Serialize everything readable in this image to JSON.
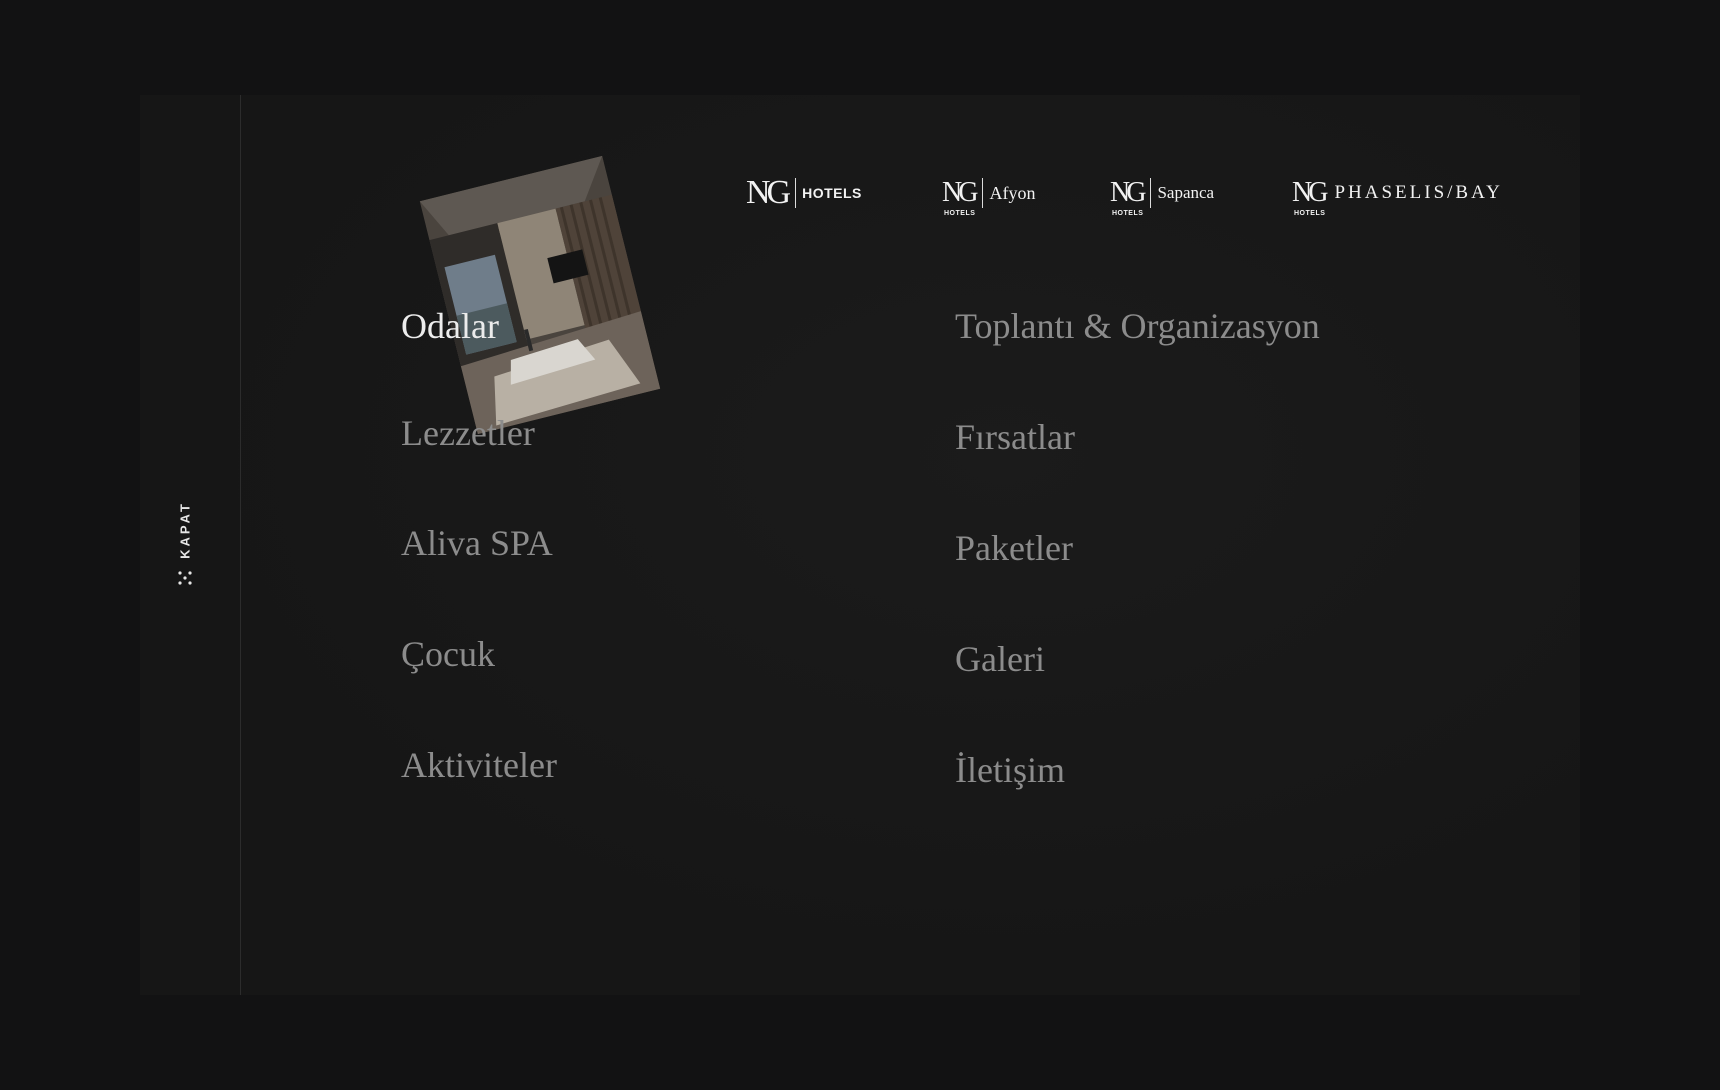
{
  "close_label": "KAPAT",
  "brands": [
    {
      "mark": "NG",
      "name": "HOTELS"
    },
    {
      "mark": "NG",
      "sub": "HOTELS",
      "name": "Afyon"
    },
    {
      "mark": "NG",
      "sub": "HOTELS",
      "name": "Sapanca"
    },
    {
      "mark": "NG",
      "sub": "HOTELS",
      "name": "PHASELIS/BAY"
    }
  ],
  "menu": {
    "left": [
      "Odalar",
      "Lezzetler",
      "Aliva SPA",
      "Çocuk",
      "Aktiviteler"
    ],
    "right": [
      "Toplantı & Organizasyon",
      "Fırsatlar",
      "Paketler",
      "Galeri",
      "İletişim"
    ],
    "active": "Odalar"
  },
  "colors": {
    "background": "#121213",
    "panel": "#171717",
    "menu_text": "#8c8c8c",
    "menu_text_active": "#ececec",
    "logo": "#f2f2f2"
  },
  "icons": {
    "close": "dots-close-icon"
  }
}
